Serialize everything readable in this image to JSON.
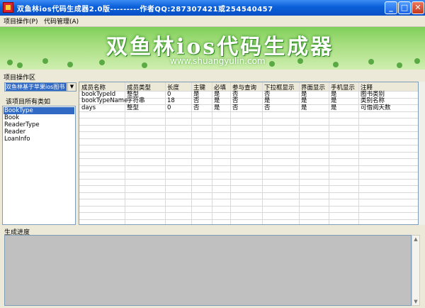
{
  "window": {
    "title": "双鱼林ios代码生成器2.0版---------作者QQ:287307421或254540457",
    "buttons": [
      "_",
      "□",
      "✕"
    ]
  },
  "menu": {
    "items": [
      "项目操作(P)",
      "代码管理(A)"
    ]
  },
  "banner": {
    "title": "双鱼林ios代码生成器",
    "url": "www.shuangyulin.com"
  },
  "project_group": {
    "label": "项目操作区",
    "combo_value": "双鱼林基于苹果ios图书",
    "list_label": "该项目所有类如",
    "classes": [
      "BookType",
      "Book",
      "ReaderType",
      "Reader",
      "LoanInfo"
    ],
    "selected_index": 0
  },
  "grid": {
    "columns": [
      "成员名称",
      "成员类型",
      "长度",
      "主键",
      "必填",
      "参与查询",
      "下拉框显示",
      "界面显示",
      "手机显示",
      "注释"
    ],
    "rows": [
      [
        "bookTypeId",
        "整型",
        "0",
        "是",
        "是",
        "否",
        "否",
        "是",
        "是",
        "图书类别"
      ],
      [
        "bookTypeName",
        "字符串",
        "18",
        "否",
        "是",
        "否",
        "是",
        "是",
        "是",
        "类别名称"
      ],
      [
        "days",
        "整型",
        "0",
        "否",
        "是",
        "否",
        "否",
        "是",
        "是",
        "可借阅天数"
      ]
    ]
  },
  "progress": {
    "label": "生成进度"
  },
  "colors": {
    "titlebar": "#0a5fd8",
    "selection": "#316ac5",
    "banner": "#a6de7e"
  }
}
